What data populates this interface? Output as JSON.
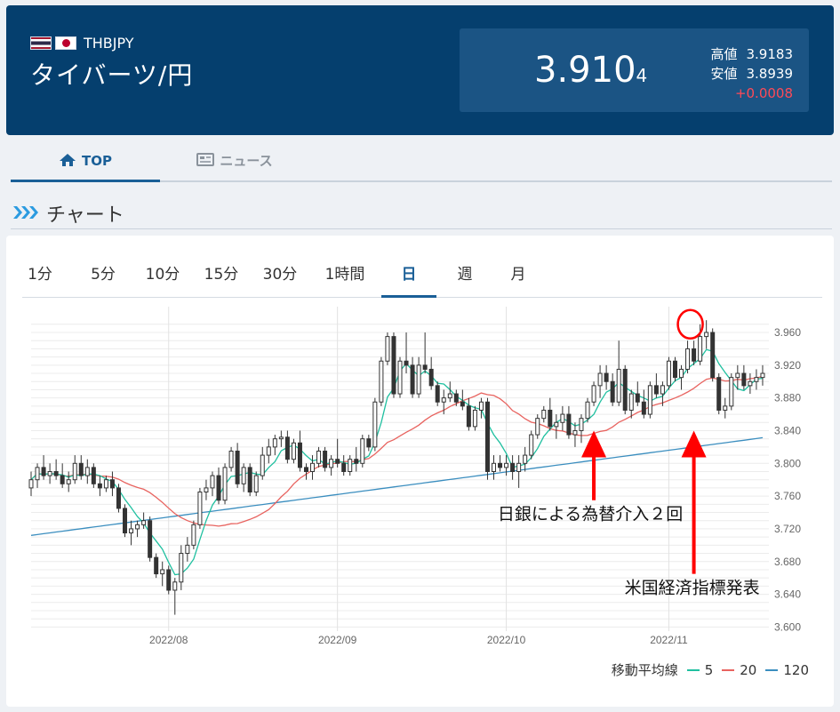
{
  "header": {
    "pair_code": "THBJPY",
    "pair_name": "タイバーツ/円",
    "price_main": "3.910",
    "price_small": "4",
    "high_label": "高値",
    "high_value": "3.9183",
    "low_label": "安値",
    "low_value": "3.8939",
    "change": "+0.0008"
  },
  "tabs": [
    {
      "label": "TOP",
      "icon": "home-icon"
    },
    {
      "label": "ニュース",
      "icon": "newspaper-icon"
    }
  ],
  "section_title": "チャート",
  "periods": [
    "1分",
    "5分",
    "10分",
    "15分",
    "30分",
    "1時間",
    "日",
    "週",
    "月"
  ],
  "active_period": "日",
  "legend": {
    "label": "移動平均線",
    "items": [
      "5",
      "20",
      "120"
    ]
  },
  "colors": {
    "header_bg": "#053f6e",
    "accent": "#1a5f97",
    "ma5": "#20c0a0",
    "ma20": "#e8635f",
    "ma120": "#3b8ebf",
    "candle": "#333333",
    "annotation": "#ff0000",
    "change": "#ff4a57"
  },
  "chart_data": {
    "type": "candlestick",
    "x_ticks": [
      "2022/08",
      "2022/09",
      "2022/10",
      "2022/11"
    ],
    "y_ticks": [
      "3.960",
      "3.920",
      "3.880",
      "3.840",
      "3.800",
      "3.760",
      "3.720",
      "3.680",
      "3.640",
      "3.600"
    ],
    "ylim": [
      3.595,
      3.985
    ],
    "xlim": [
      0,
      118
    ],
    "x_tick_index": [
      22,
      49,
      76,
      102
    ],
    "candles": [
      [
        3.77,
        3.79,
        3.76,
        3.78
      ],
      [
        3.78,
        3.8,
        3.77,
        3.795
      ],
      [
        3.795,
        3.81,
        3.78,
        3.785
      ],
      [
        3.785,
        3.8,
        3.775,
        3.79
      ],
      [
        3.79,
        3.805,
        3.78,
        3.785
      ],
      [
        3.785,
        3.8,
        3.77,
        3.775
      ],
      [
        3.775,
        3.79,
        3.765,
        3.78
      ],
      [
        3.78,
        3.81,
        3.775,
        3.8
      ],
      [
        3.8,
        3.81,
        3.78,
        3.785
      ],
      [
        3.785,
        3.805,
        3.775,
        3.795
      ],
      [
        3.795,
        3.8,
        3.77,
        3.775
      ],
      [
        3.775,
        3.785,
        3.76,
        3.77
      ],
      [
        3.77,
        3.785,
        3.765,
        3.78
      ],
      [
        3.78,
        3.79,
        3.76,
        3.77
      ],
      [
        3.77,
        3.775,
        3.74,
        3.745
      ],
      [
        3.745,
        3.75,
        3.71,
        3.715
      ],
      [
        3.715,
        3.73,
        3.7,
        3.72
      ],
      [
        3.72,
        3.73,
        3.71,
        3.725
      ],
      [
        3.725,
        3.74,
        3.72,
        3.73
      ],
      [
        3.73,
        3.735,
        3.68,
        3.685
      ],
      [
        3.685,
        3.69,
        3.66,
        3.665
      ],
      [
        3.665,
        3.68,
        3.65,
        3.67
      ],
      [
        3.67,
        3.675,
        3.64,
        3.645
      ],
      [
        3.645,
        3.66,
        3.615,
        3.655
      ],
      [
        3.655,
        3.7,
        3.645,
        3.69
      ],
      [
        3.69,
        3.71,
        3.68,
        3.7
      ],
      [
        3.7,
        3.73,
        3.695,
        3.725
      ],
      [
        3.725,
        3.77,
        3.72,
        3.765
      ],
      [
        3.765,
        3.78,
        3.755,
        3.77
      ],
      [
        3.77,
        3.79,
        3.76,
        3.785
      ],
      [
        3.785,
        3.795,
        3.75,
        3.755
      ],
      [
        3.755,
        3.8,
        3.75,
        3.795
      ],
      [
        3.795,
        3.82,
        3.79,
        3.815
      ],
      [
        3.815,
        3.825,
        3.77,
        3.775
      ],
      [
        3.775,
        3.8,
        3.765,
        3.795
      ],
      [
        3.795,
        3.8,
        3.76,
        3.765
      ],
      [
        3.765,
        3.79,
        3.76,
        3.785
      ],
      [
        3.785,
        3.82,
        3.78,
        3.81
      ],
      [
        3.81,
        3.83,
        3.8,
        3.82
      ],
      [
        3.82,
        3.835,
        3.81,
        3.83
      ],
      [
        3.83,
        3.84,
        3.82,
        3.832
      ],
      [
        3.832,
        3.84,
        3.8,
        3.805
      ],
      [
        3.805,
        3.83,
        3.8,
        3.825
      ],
      [
        3.825,
        3.84,
        3.79,
        3.795
      ],
      [
        3.795,
        3.8,
        3.78,
        3.79
      ],
      [
        3.79,
        3.81,
        3.78,
        3.8
      ],
      [
        3.8,
        3.82,
        3.795,
        3.815
      ],
      [
        3.815,
        3.82,
        3.79,
        3.795
      ],
      [
        3.795,
        3.81,
        3.785,
        3.805
      ],
      [
        3.805,
        3.83,
        3.795,
        3.8
      ],
      [
        3.8,
        3.81,
        3.785,
        3.79
      ],
      [
        3.79,
        3.81,
        3.785,
        3.805
      ],
      [
        3.805,
        3.82,
        3.79,
        3.8
      ],
      [
        3.8,
        3.835,
        3.795,
        3.83
      ],
      [
        3.83,
        3.835,
        3.815,
        3.82
      ],
      [
        3.82,
        3.88,
        3.815,
        3.875
      ],
      [
        3.875,
        3.93,
        3.87,
        3.925
      ],
      [
        3.925,
        3.96,
        3.92,
        3.955
      ],
      [
        3.955,
        3.96,
        3.88,
        3.885
      ],
      [
        3.885,
        3.93,
        3.88,
        3.925
      ],
      [
        3.925,
        3.96,
        3.91,
        3.92
      ],
      [
        3.92,
        3.93,
        3.88,
        3.885
      ],
      [
        3.885,
        3.93,
        3.88,
        3.92
      ],
      [
        3.92,
        3.96,
        3.91,
        3.915
      ],
      [
        3.915,
        3.93,
        3.89,
        3.895
      ],
      [
        3.895,
        3.9,
        3.87,
        3.875
      ],
      [
        3.875,
        3.89,
        3.86,
        3.88
      ],
      [
        3.88,
        3.9,
        3.875,
        3.885
      ],
      [
        3.885,
        3.89,
        3.87,
        3.875
      ],
      [
        3.875,
        3.89,
        3.865,
        3.87
      ],
      [
        3.87,
        3.88,
        3.84,
        3.845
      ],
      [
        3.845,
        3.87,
        3.84,
        3.865
      ],
      [
        3.865,
        3.88,
        3.855,
        3.875
      ],
      [
        3.875,
        3.88,
        3.78,
        3.79
      ],
      [
        3.79,
        3.81,
        3.78,
        3.8
      ],
      [
        3.8,
        3.81,
        3.79,
        3.795
      ],
      [
        3.795,
        3.81,
        3.785,
        3.8
      ],
      [
        3.8,
        3.81,
        3.78,
        3.79
      ],
      [
        3.79,
        3.81,
        3.77,
        3.8
      ],
      [
        3.8,
        3.82,
        3.79,
        3.81
      ],
      [
        3.81,
        3.84,
        3.805,
        3.835
      ],
      [
        3.835,
        3.86,
        3.83,
        3.855
      ],
      [
        3.855,
        3.87,
        3.85,
        3.865
      ],
      [
        3.865,
        3.88,
        3.84,
        3.845
      ],
      [
        3.845,
        3.86,
        3.83,
        3.85
      ],
      [
        3.85,
        3.87,
        3.84,
        3.86
      ],
      [
        3.86,
        3.87,
        3.83,
        3.835
      ],
      [
        3.835,
        3.85,
        3.82,
        3.84
      ],
      [
        3.84,
        3.86,
        3.825,
        3.855
      ],
      [
        3.855,
        3.88,
        3.85,
        3.875
      ],
      [
        3.875,
        3.9,
        3.87,
        3.895
      ],
      [
        3.895,
        3.92,
        3.88,
        3.91
      ],
      [
        3.91,
        3.92,
        3.89,
        3.9
      ],
      [
        3.9,
        3.91,
        3.87,
        3.875
      ],
      [
        3.875,
        3.95,
        3.87,
        3.915
      ],
      [
        3.915,
        3.92,
        3.86,
        3.865
      ],
      [
        3.865,
        3.89,
        3.855,
        3.885
      ],
      [
        3.885,
        3.9,
        3.87,
        3.875
      ],
      [
        3.875,
        3.89,
        3.855,
        3.86
      ],
      [
        3.86,
        3.9,
        3.855,
        3.895
      ],
      [
        3.895,
        3.91,
        3.88,
        3.885
      ],
      [
        3.885,
        3.9,
        3.87,
        3.895
      ],
      [
        3.895,
        3.93,
        3.89,
        3.925
      ],
      [
        3.925,
        3.93,
        3.9,
        3.905
      ],
      [
        3.905,
        3.92,
        3.89,
        3.915
      ],
      [
        3.915,
        3.95,
        3.91,
        3.94
      ],
      [
        3.94,
        3.95,
        3.92,
        3.925
      ],
      [
        3.925,
        3.97,
        3.92,
        3.955
      ],
      [
        3.955,
        3.975,
        3.94,
        3.96
      ],
      [
        3.96,
        3.965,
        3.9,
        3.905
      ],
      [
        3.905,
        3.91,
        3.86,
        3.865
      ],
      [
        3.865,
        3.88,
        3.855,
        3.87
      ],
      [
        3.87,
        3.91,
        3.865,
        3.905
      ],
      [
        3.905,
        3.92,
        3.89,
        3.91
      ],
      [
        3.91,
        3.92,
        3.89,
        3.895
      ],
      [
        3.895,
        3.91,
        3.885,
        3.9
      ],
      [
        3.9,
        3.915,
        3.89,
        3.905
      ],
      [
        3.905,
        3.92,
        3.895,
        3.91
      ]
    ],
    "annotations": [
      {
        "text": "日銀による為替介入２回",
        "x": 90,
        "y_from": 3.755,
        "y_to": 3.84
      },
      {
        "text": "米国経済指標発表",
        "x": 106,
        "y_from": 3.665,
        "y_to": 3.84
      },
      {
        "text": "",
        "x": 106,
        "circle_y": 3.97
      }
    ]
  }
}
